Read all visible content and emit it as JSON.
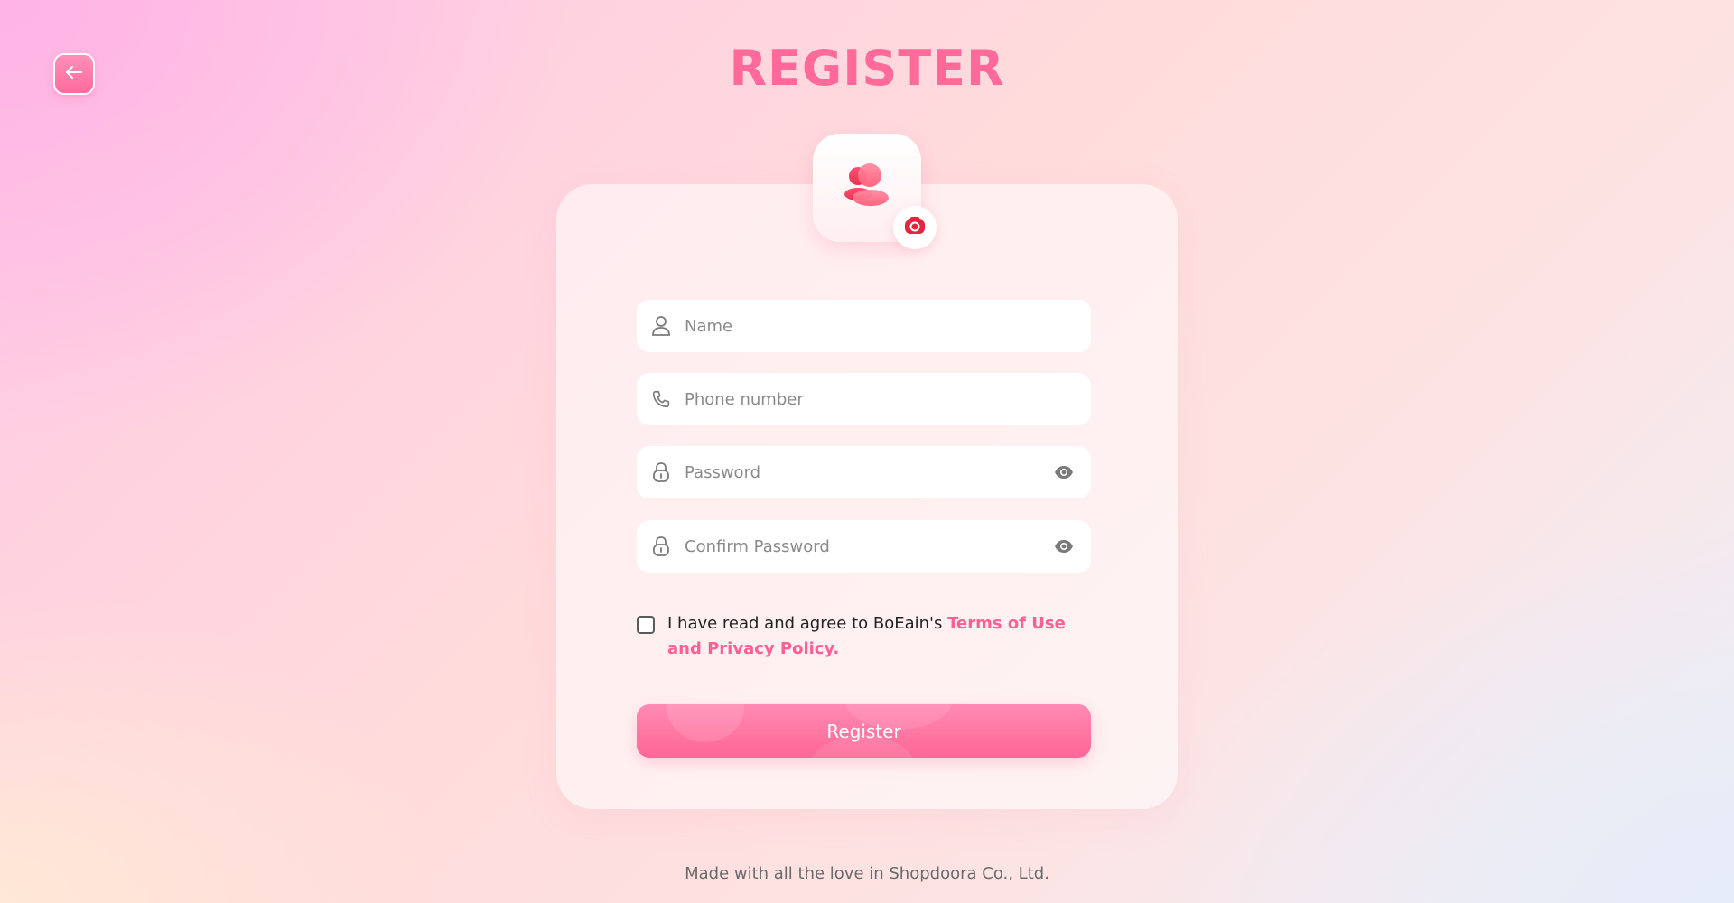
{
  "header": {
    "title": "REGISTER",
    "back_icon": "arrow-left-icon"
  },
  "avatar": {
    "icon": "users-icon",
    "badge_icon": "camera-icon"
  },
  "form": {
    "name": {
      "placeholder": "Name",
      "value": "",
      "icon": "user-icon"
    },
    "phone": {
      "placeholder": "Phone number",
      "value": "",
      "icon": "phone-icon"
    },
    "password": {
      "placeholder": "Password",
      "value": "",
      "icon": "lock-icon",
      "toggle_icon": "eye-icon"
    },
    "confirm_password": {
      "placeholder": "Confirm Password",
      "value": "",
      "icon": "lock-icon",
      "toggle_icon": "eye-icon"
    },
    "agree": {
      "checked": false,
      "text": "I have read and agree to BoEain's ",
      "link_text": "Terms of Use and Privacy Policy."
    },
    "submit_label": "Register"
  },
  "footer": {
    "text": "Made with all the love in Shopdoora Co., Ltd."
  },
  "colors": {
    "accent": "#ff6a9a",
    "link": "#ff5f95",
    "button_top": "#ff8ab3",
    "button_bottom": "#ff6696"
  }
}
